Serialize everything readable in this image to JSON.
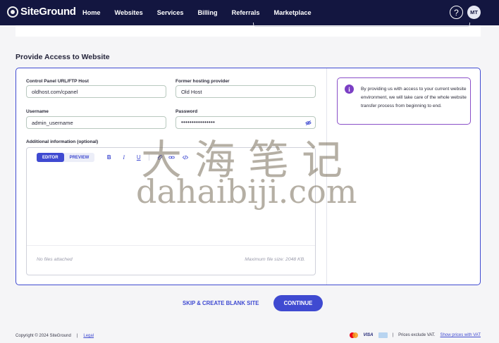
{
  "nav": {
    "logo": "SiteGround",
    "links": [
      "Home",
      "Websites",
      "Services",
      "Billing",
      "Referrals",
      "Marketplace"
    ],
    "help_icon": "?",
    "avatar_initials": "MT",
    "bg_color": "#131640"
  },
  "section_title": "Provide Access to Website",
  "form": {
    "cpanel_label": "Control Panel URL/FTP Host",
    "cpanel_value": "oldhost.com/cpanel",
    "provider_label": "Former hosting provider",
    "provider_value": "Old Host",
    "username_label": "Username",
    "username_value": "admin_username",
    "password_label": "Password",
    "password_mask": "••••••••••••••••",
    "additional_label": "Additional information (optional)"
  },
  "editor": {
    "tab_editor": "EDITOR",
    "tab_preview": "PREVIEW",
    "tools": [
      "B",
      "I",
      "U"
    ],
    "no_files": "No files attached",
    "max_size": "Maximum file size: 2048 KB."
  },
  "info": {
    "icon": "i",
    "text": "By providing us with access to your current website environment, we will take care of the whole website transfer process from beginning to end."
  },
  "actions": {
    "skip": "SKIP & CREATE BLANK SITE",
    "continue": "CONTINUE",
    "accent_color": "#3f4ad1"
  },
  "footer": {
    "copyright": "Copyright © 2024 SiteGround",
    "separator": "|",
    "legal": "Legal",
    "visa": "VISA",
    "vat_text": "Prices exclude VAT.",
    "vat_link": "Show prices with VAT"
  },
  "watermark": {
    "cn": "大海笔记",
    "en": "dahaibiji.com"
  }
}
